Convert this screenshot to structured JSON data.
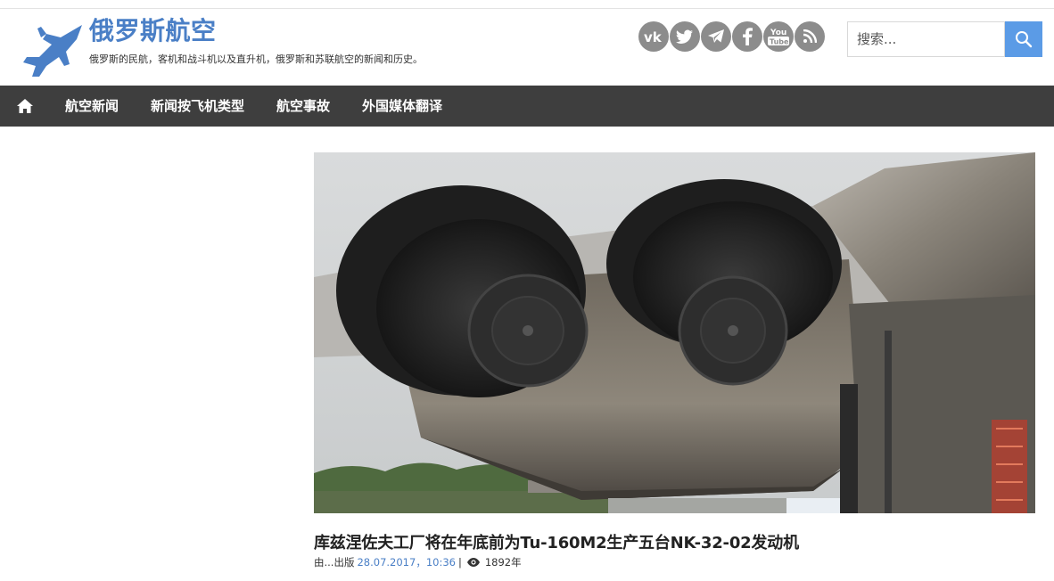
{
  "header": {
    "site_title": "俄罗斯航空",
    "tagline": "俄罗斯的民航，客机和战斗机以及直升机，俄罗斯和苏联航空的新闻和历史。",
    "logo_icon": "fighter-jet-icon",
    "social": [
      "vk-icon",
      "twitter-icon",
      "telegram-icon",
      "facebook-icon",
      "youtube-icon",
      "rss-icon"
    ],
    "search_placeholder": "搜索...",
    "accent_color": "#4a7fc6",
    "search_button_color": "#5b9be6"
  },
  "nav": {
    "home_icon": "home-icon",
    "items": [
      "航空新闻",
      "新闻按飞机类型",
      "航空事故",
      "外国媒体翻译"
    ],
    "bg_color": "#3e3e3e"
  },
  "article": {
    "image_subject": "jet-engine-nozzles",
    "title": "库兹涅佐夫工厂将在年底前为Tu-160M2生产五台NK-32-02发动机",
    "meta_prefix": "由...出版",
    "date": "28.07.2017，10:36",
    "separator": "|",
    "views": "1892年"
  }
}
